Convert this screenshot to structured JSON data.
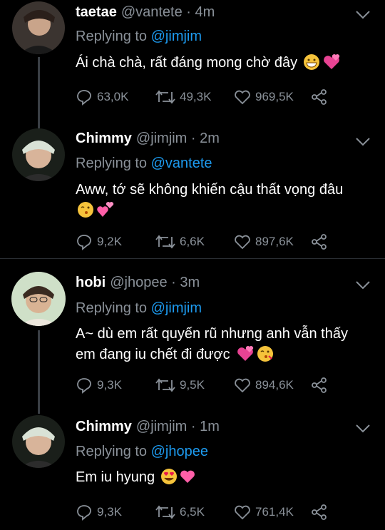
{
  "tweets": [
    {
      "name": "taetae",
      "meta": "@vantete · 4m",
      "replying_prefix": "Replying to",
      "replying_to": "@jimjim",
      "text": "Ái chà chà, rất đáng mong chờ đây",
      "reply_count": "63,0K",
      "retweet_count": "49,3K",
      "like_count": "969,5K"
    },
    {
      "name": "Chimmy",
      "meta": "@jimjim · 2m",
      "replying_prefix": "Replying to",
      "replying_to": "@vantete",
      "text": "Aww, tớ sẽ không khiến cậu thất vọng đâu",
      "reply_count": "9,2K",
      "retweet_count": "6,6K",
      "like_count": "897,6K"
    },
    {
      "name": "hobi",
      "meta": "@jhopee · 3m",
      "replying_prefix": "Replying to",
      "replying_to": "@jimjim",
      "text_line1": "A~ dù em rất quyến rũ nhưng anh vẫn thấy",
      "text_line2": "em đang iu chết đi được",
      "reply_count": "9,3K",
      "retweet_count": "9,5K",
      "like_count": "894,6K"
    },
    {
      "name": "Chimmy",
      "meta": "@jimjim · 1m",
      "replying_prefix": "Replying to",
      "replying_to": "@jhopee",
      "text": "Em iu hyung",
      "reply_count": "9,3K",
      "retweet_count": "6,5K",
      "like_count": "761,4K"
    }
  ],
  "icons": {
    "reply": "reply-icon",
    "retweet": "retweet-icon",
    "like": "heart-icon",
    "share": "share-icon",
    "more": "chevron-down-icon"
  },
  "colors": {
    "background": "#000000",
    "muted": "#8a9199",
    "link": "#1d9bf0"
  }
}
